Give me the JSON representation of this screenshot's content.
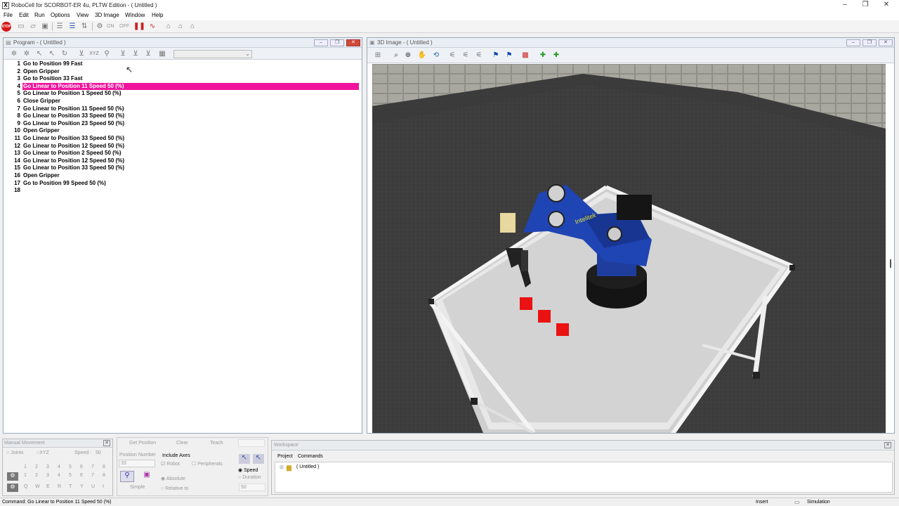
{
  "window": {
    "title": "RoboCell for SCORBOT-ER 4u, PLTW Edition - ( Untitled )",
    "app_icon": "X"
  },
  "menu": [
    "File",
    "Edit",
    "Run",
    "Options",
    "View",
    "3D Image",
    "Window",
    "Help"
  ],
  "toolbar": {
    "stop_label": "STOP",
    "on_label": "ON",
    "off_label": "OFF"
  },
  "program": {
    "title": "Program - ( Untitled )",
    "selected_index": 3,
    "lines": [
      {
        "num": "1",
        "text": "Go to Position 99 Fast"
      },
      {
        "num": "2",
        "text": "Open Gripper"
      },
      {
        "num": "3",
        "text": "Go to Position 33 Fast"
      },
      {
        "num": "4",
        "text": "Go Linear to Position 11 Speed 50 (%)"
      },
      {
        "num": "5",
        "text": "Go Linear to Position 1 Speed 50 (%)"
      },
      {
        "num": "6",
        "text": "Close Gripper"
      },
      {
        "num": "7",
        "text": "Go Linear to Position 11 Speed 50 (%)"
      },
      {
        "num": "8",
        "text": "Go Linear to Position 33 Speed 50 (%)"
      },
      {
        "num": "9",
        "text": "Go Linear to Position 23 Speed 50 (%)"
      },
      {
        "num": "10",
        "text": "Open Gripper"
      },
      {
        "num": "11",
        "text": "Go Linear to Position 33 Speed 50 (%)"
      },
      {
        "num": "12",
        "text": "Go Linear to Position 12 Speed 50 (%)"
      },
      {
        "num": "13",
        "text": "Go Linear to Position 2 Speed 50 (%)"
      },
      {
        "num": "14",
        "text": "Go Linear to Position 12 Speed 50 (%)"
      },
      {
        "num": "15",
        "text": "Go Linear to Position 33 Speed 50 (%)"
      },
      {
        "num": "16",
        "text": "Open Gripper"
      },
      {
        "num": "17",
        "text": "Go to Position 99 Speed 50 (%)"
      },
      {
        "num": "18",
        "text": ""
      }
    ]
  },
  "view3d": {
    "title": "3D Image - ( Untitled )",
    "robot_brand": "Intelitek",
    "robot_model": "SCORBOT-ER 4u"
  },
  "manual": {
    "title": "Manual Movement",
    "joints_label": "Joints",
    "xyz_label": "XYZ",
    "speed_label": "Speed :",
    "speed_value": "50",
    "row1": [
      "1",
      "2",
      "3",
      "4",
      "5",
      "6",
      "7",
      "8"
    ],
    "row2": [
      "1",
      "2",
      "3",
      "4",
      "5",
      "6",
      "7",
      "8"
    ],
    "row3": [
      "Q",
      "W",
      "E",
      "R",
      "T",
      "Y",
      "U",
      "I"
    ]
  },
  "teach": {
    "get_position": "Get Position",
    "clear": "Clear",
    "teach": "Teach",
    "position_number_label": "Position Number",
    "position_number_value": "33",
    "include_axes_label": "Include Axes",
    "robot_label": "Robot",
    "peripherals_label": "Peripherals",
    "absolute_label": "Absolute",
    "relative_label": "Relative to",
    "simple_label": "Simple",
    "speed_label": "Speed",
    "duration_label": "Duration",
    "speed_value": "50"
  },
  "workspace": {
    "title": "Workspace",
    "tabs": [
      "Project",
      "Commands"
    ],
    "tree_root": "( Untitled )"
  },
  "status": {
    "command": "Command:  Go Linear to Position 11 Speed 50 (%)",
    "mode": "Insert",
    "state": "Simulation"
  }
}
